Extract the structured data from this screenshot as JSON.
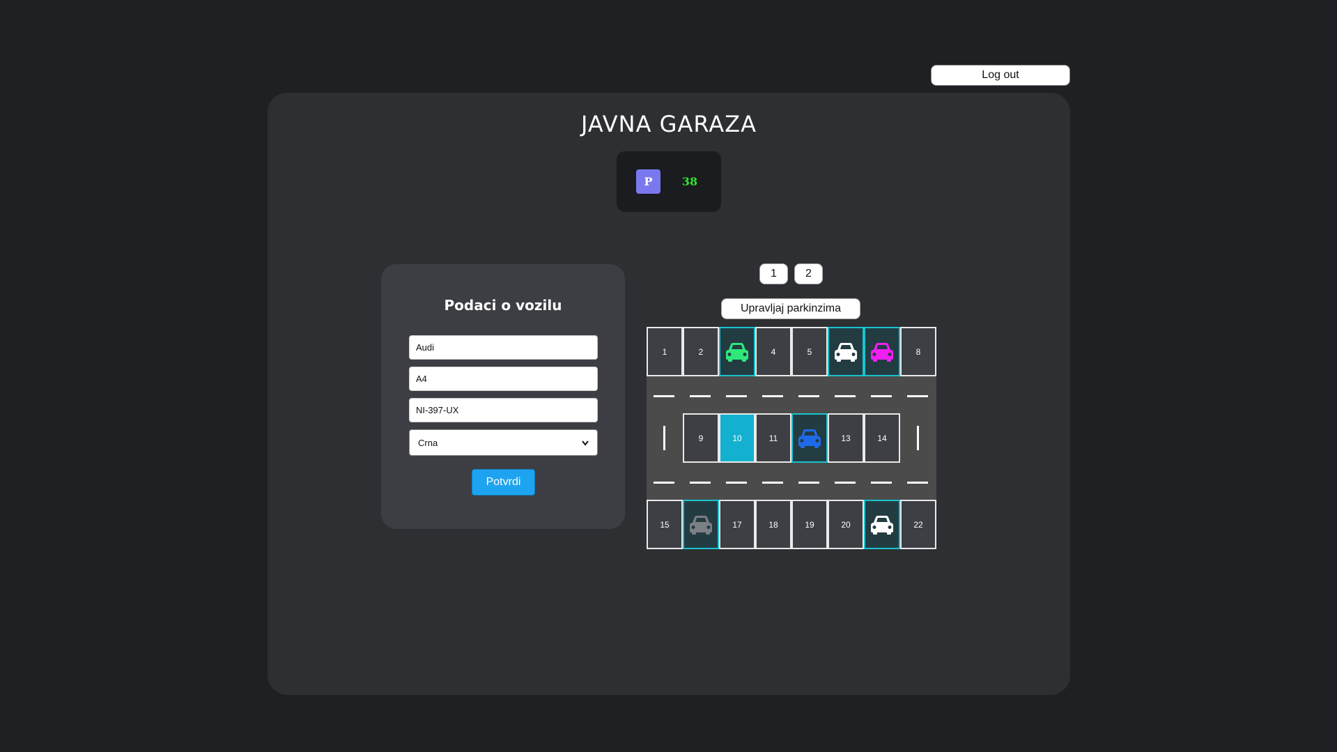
{
  "header": {
    "logout_label": "Log out"
  },
  "app": {
    "title": "JAVNA GARAZA",
    "parking_badge": "P",
    "free_spots": "38"
  },
  "form": {
    "title": "Podaci o vozilu",
    "brand_value": "Audi",
    "model_value": "A4",
    "plate_value": "NI-397-UX",
    "color_selected": "Crna",
    "submit_label": "Potvrdi"
  },
  "levels": [
    {
      "label": "1"
    },
    {
      "label": "2"
    }
  ],
  "manage_label": "Upravljaj parkinzima",
  "colors": {
    "accent": "#1ea3f0",
    "occupied_border": "#18c4d0",
    "selected_spot": "#13b1cf",
    "free_count": "#2ee62e",
    "badge": "#7a78ee"
  },
  "spots": {
    "top_row": [
      {
        "label": "1",
        "car": null
      },
      {
        "label": "2",
        "car": null
      },
      {
        "label": "",
        "car": "#2ee87a"
      },
      {
        "label": "4",
        "car": null
      },
      {
        "label": "5",
        "car": null
      },
      {
        "label": "",
        "car": "#ffffff"
      },
      {
        "label": "",
        "car": "#f21ef2"
      },
      {
        "label": "8",
        "car": null
      }
    ],
    "middle_row": [
      {
        "label": "9",
        "car": null
      },
      {
        "label": "10",
        "car": null,
        "selected": true
      },
      {
        "label": "11",
        "car": null
      },
      {
        "label": "",
        "car": "#1f6ae8"
      },
      {
        "label": "13",
        "car": null
      },
      {
        "label": "14",
        "car": null
      }
    ],
    "bottom_row": [
      {
        "label": "15",
        "car": null
      },
      {
        "label": "",
        "car": "#7c7f84"
      },
      {
        "label": "17",
        "car": null
      },
      {
        "label": "18",
        "car": null
      },
      {
        "label": "19",
        "car": null
      },
      {
        "label": "20",
        "car": null
      },
      {
        "label": "",
        "car": "#ffffff"
      },
      {
        "label": "22",
        "car": null
      }
    ]
  }
}
